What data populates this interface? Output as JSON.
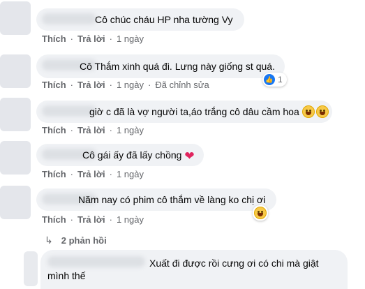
{
  "actions": {
    "like": "Thích",
    "reply": "Trả lời",
    "separator": "·",
    "edited": "Đã chỉnh sửa"
  },
  "comments": [
    {
      "text": "Cô chúc cháu HP nha tường Vy",
      "time": "1 ngày"
    },
    {
      "text": "Cô Thắm xinh quá đi. Lưng này giống st quá.",
      "time": "1 ngày",
      "reaction_count": "1",
      "reaction_icon": "like-icon"
    },
    {
      "text": "giờ c đã là vợ người ta,áo trắng cô dâu cầm hoa",
      "time": "1 ngày",
      "emojis": [
        "grin-emoji",
        "laugh-tears-emoji"
      ]
    },
    {
      "text": "Cô gái ấy đã lấy chồng",
      "time": "1 ngày",
      "emojis": [
        "red-heart-emoji"
      ]
    },
    {
      "text": "Năm nay có phim cô thắm về làng ko chị ơi",
      "time": "1 ngày",
      "reaction_icon": "laugh-emoji"
    }
  ],
  "replies_link": "2 phản hồi",
  "reply_comment": {
    "line1": "Xuất đi được rồi cưng ơi có chi mà giật",
    "line2": "mình thế"
  }
}
